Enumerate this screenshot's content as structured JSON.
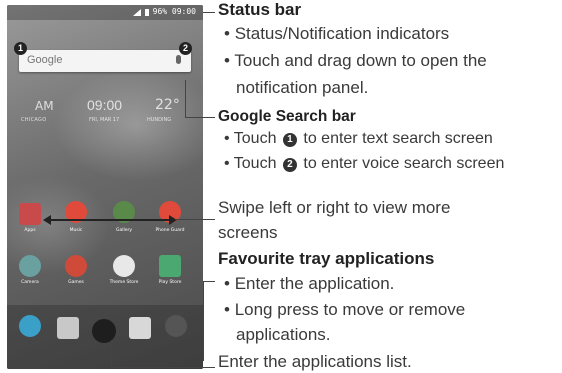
{
  "phone": {
    "status_text": "96% 09:00",
    "search_logo": "Google",
    "clock_ampm": "AM",
    "clock_time": "09:00",
    "clock_temp": "22°",
    "clock_city": "CHICAGO",
    "clock_date": "FRI, MAR 17",
    "clock_weather": "HUNDING",
    "apps_row1": [
      "Apps",
      "Music",
      "Gallery",
      "Phone Guard"
    ],
    "apps_row2": [
      "Camera",
      "Games",
      "Theme Store",
      "Play Store"
    ]
  },
  "callouts": {
    "one": "1",
    "two": "2"
  },
  "annotations": {
    "status_bar_title": "Status bar",
    "status_bullet_1": "Status/Notification indicators",
    "status_bullet_2a": "Touch and drag down to open the",
    "status_bullet_2b": "notification panel.",
    "search_title": "Google Search bar",
    "search_bullet_1_pre": "Touch",
    "search_bullet_1_post": "to enter text search screen",
    "search_bullet_2_pre": "Touch",
    "search_bullet_2_post": "to enter voice search screen",
    "swipe_a": "Swipe left or right to view more",
    "swipe_b": "screens",
    "fav_title": "Favourite tray applications",
    "fav_bullet_1": "Enter the application.",
    "fav_bullet_2a": "Long press to move or remove",
    "fav_bullet_2b": "applications.",
    "apps_list": "Enter the applications list."
  }
}
